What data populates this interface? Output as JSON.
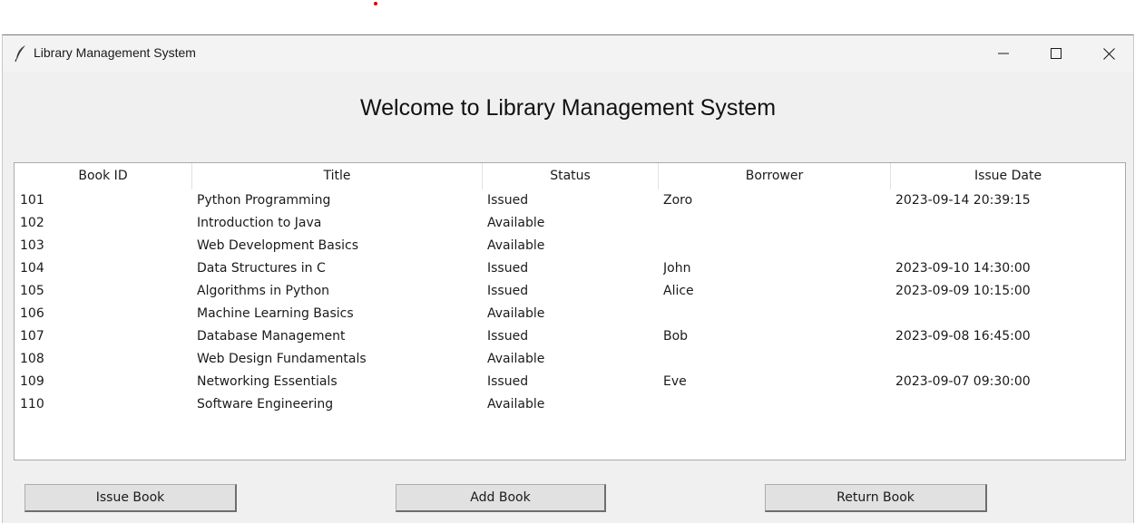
{
  "window": {
    "title": "Library Management System",
    "icon": "feather-icon",
    "controls": [
      "minimize-icon",
      "maximize-icon",
      "close-icon"
    ]
  },
  "heading": "Welcome to Library Management System",
  "table": {
    "columns": [
      "Book ID",
      "Title",
      "Status",
      "Borrower",
      "Issue Date"
    ],
    "rows": [
      [
        "101",
        "Python Programming",
        "Issued",
        "Zoro",
        "2023-09-14 20:39:15"
      ],
      [
        "102",
        "Introduction to Java",
        "Available",
        "",
        ""
      ],
      [
        "103",
        "Web Development Basics",
        "Available",
        "",
        ""
      ],
      [
        "104",
        "Data Structures in C",
        "Issued",
        "John",
        "2023-09-10 14:30:00"
      ],
      [
        "105",
        "Algorithms in Python",
        "Issued",
        "Alice",
        "2023-09-09 10:15:00"
      ],
      [
        "106",
        "Machine Learning Basics",
        "Available",
        "",
        ""
      ],
      [
        "107",
        "Database Management",
        "Issued",
        "Bob",
        "2023-09-08 16:45:00"
      ],
      [
        "108",
        "Web Design Fundamentals",
        "Available",
        "",
        ""
      ],
      [
        "109",
        "Networking Essentials",
        "Issued",
        "Eve",
        "2023-09-07 09:30:00"
      ],
      [
        "110",
        "Software Engineering",
        "Available",
        "",
        ""
      ]
    ]
  },
  "buttons": {
    "issue": "Issue Book",
    "add": "Add Book",
    "return": "Return Book"
  },
  "colors": {
    "window_bg": "#f0f0f0",
    "button_bg": "#e1e1e1",
    "table_bg": "#ffffff"
  }
}
